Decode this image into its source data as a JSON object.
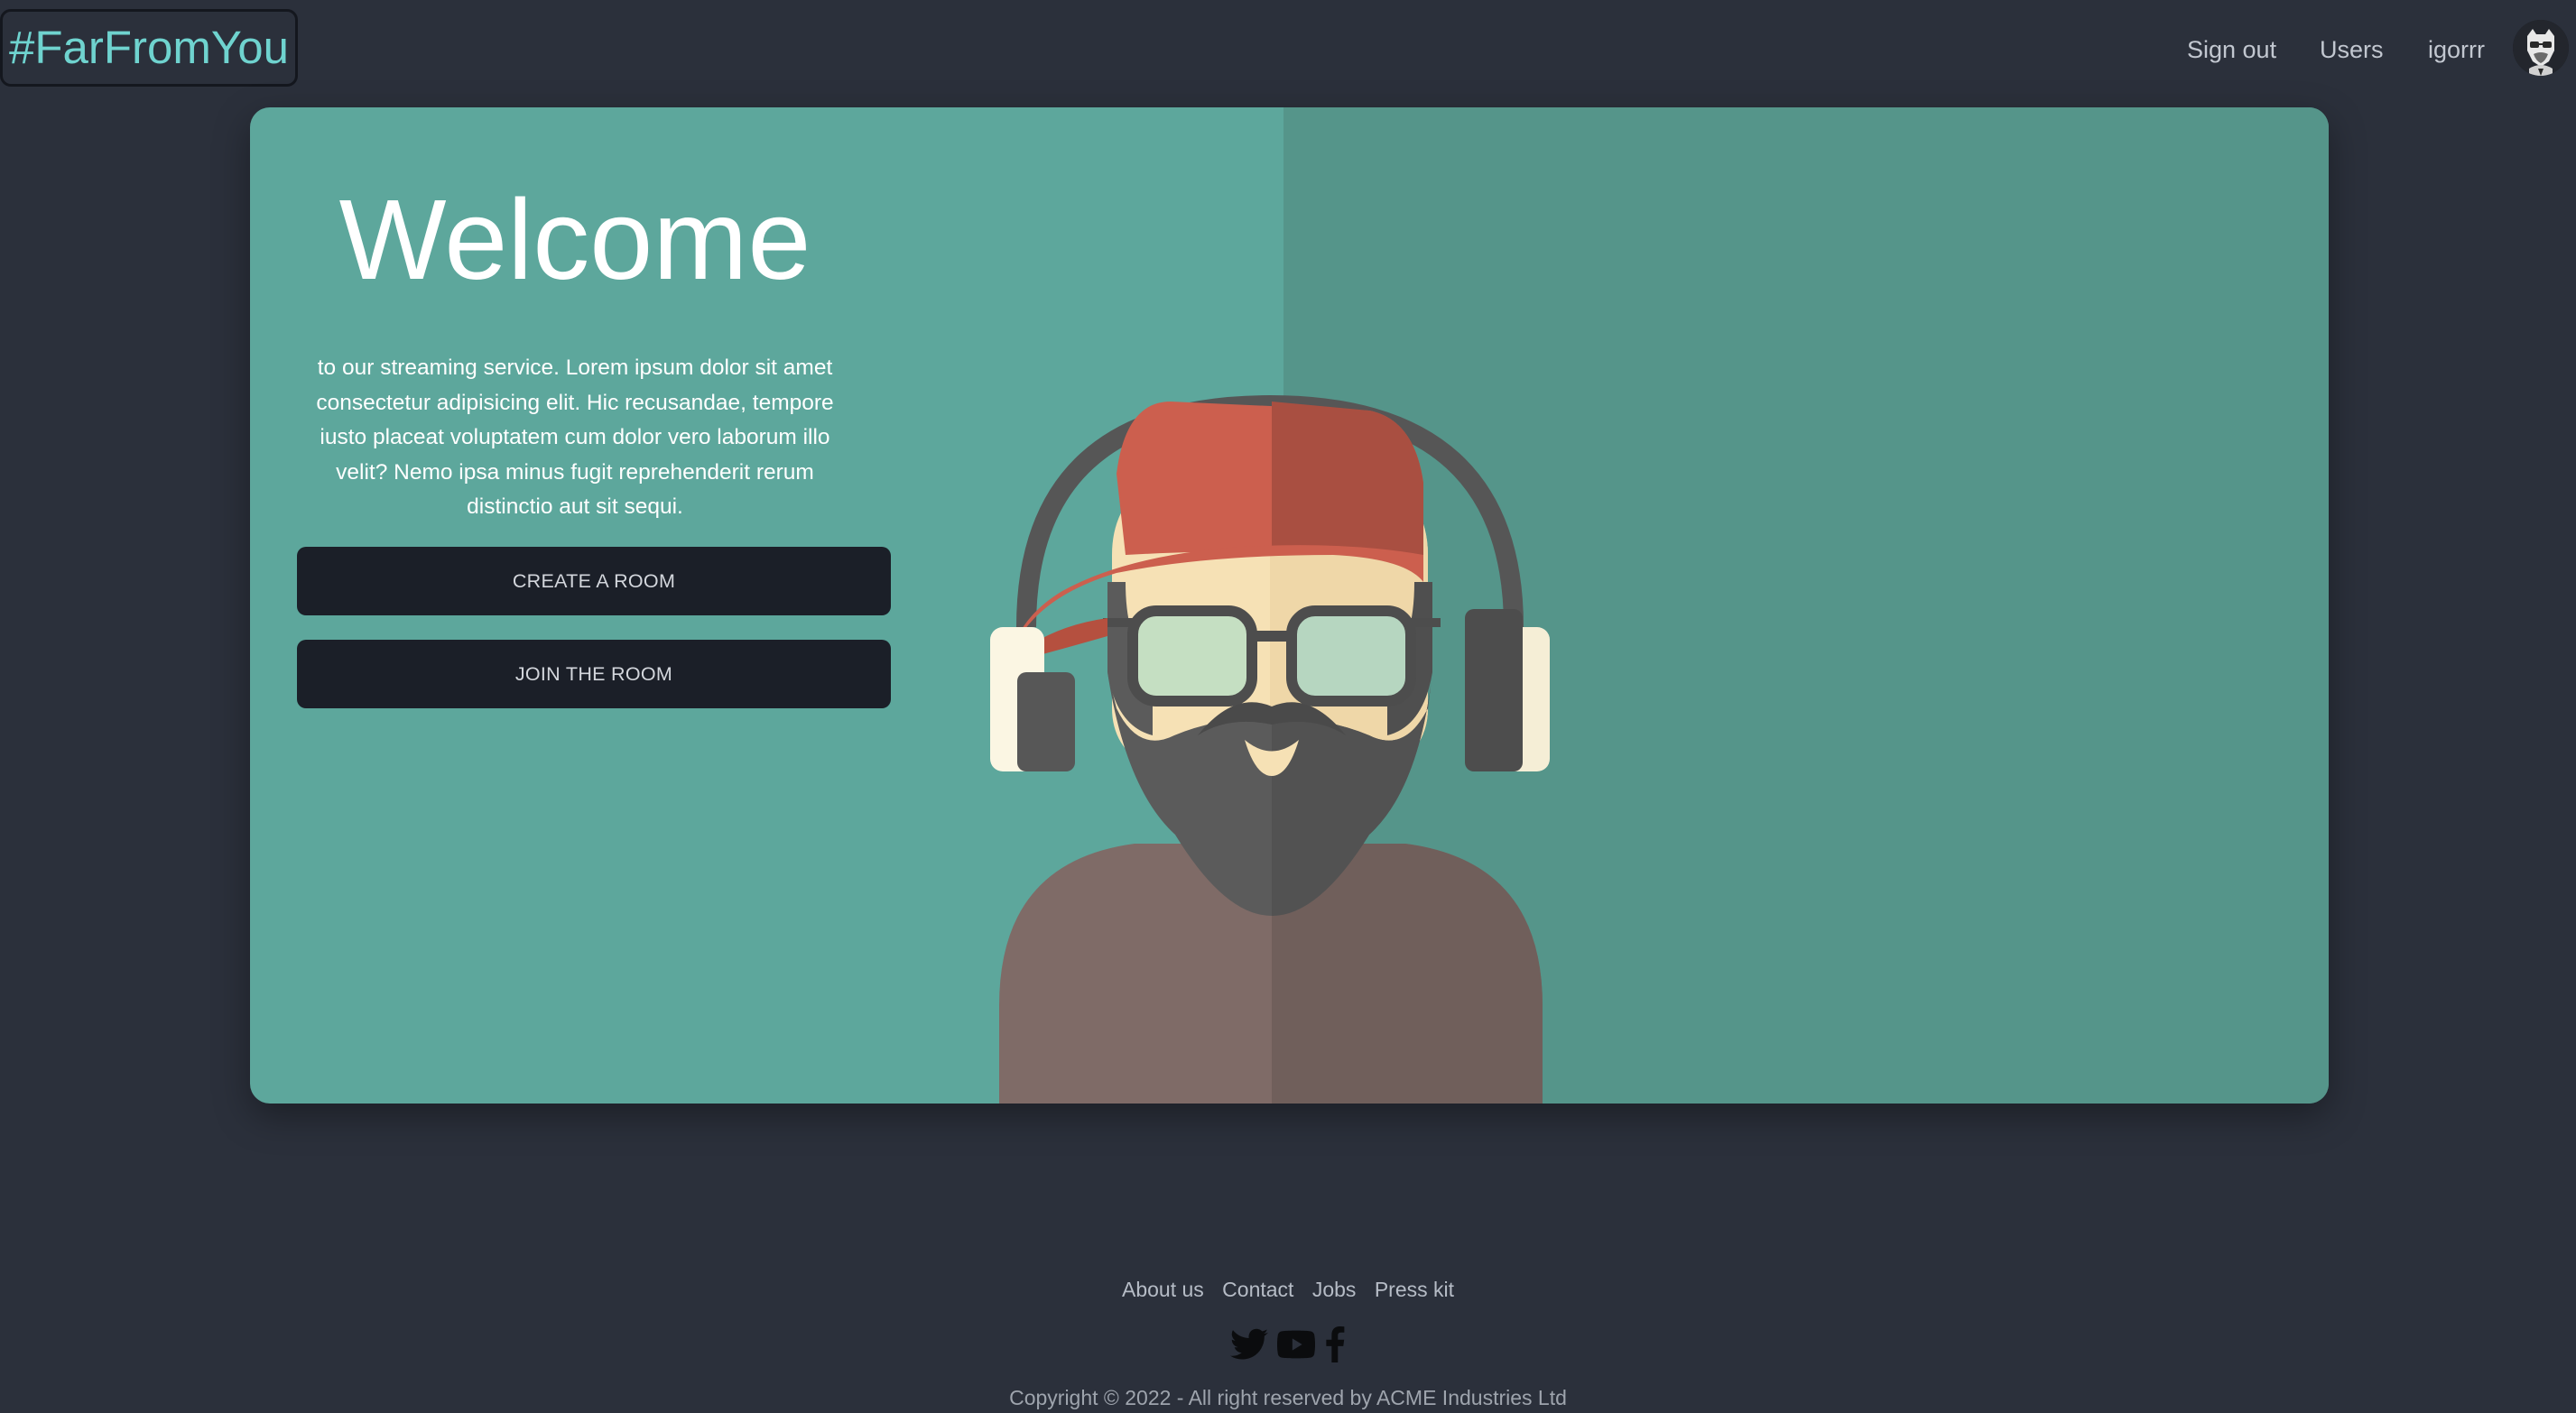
{
  "header": {
    "logo": "#FarFromYou",
    "nav": {
      "sign_out": "Sign out",
      "users": "Users",
      "username": "igorrr"
    },
    "avatar_icon": "user-avatar-icon"
  },
  "hero": {
    "title": "Welcome",
    "description": "to our streaming service. Lorem ipsum dolor sit amet consectetur adipisicing elit. Hic recusandae, tempore iusto placeat voluptatem cum dolor vero laborum illo velit? Nemo ipsa minus fugit reprehenderit rerum distinctio aut sit sequi.",
    "create_button": "CREATE A ROOM",
    "join_button": "JOIN THE ROOM",
    "illustration_icon": "bearded-man-headphones-illustration"
  },
  "footer": {
    "links": [
      "About us",
      "Contact",
      "Jobs",
      "Press kit"
    ],
    "social_icons": [
      "twitter-icon",
      "youtube-icon",
      "facebook-icon"
    ],
    "copyright": "Copyright © 2022 - All right reserved by ACME Industries Ltd"
  },
  "colors": {
    "page_bg": "#2b303b",
    "hero_bg": "#5da79c",
    "hero_bg_right": "#55958a",
    "logo_text": "#6fd3cf",
    "button_bg": "#1b1f28",
    "cap_red": "#cc5f4e"
  }
}
